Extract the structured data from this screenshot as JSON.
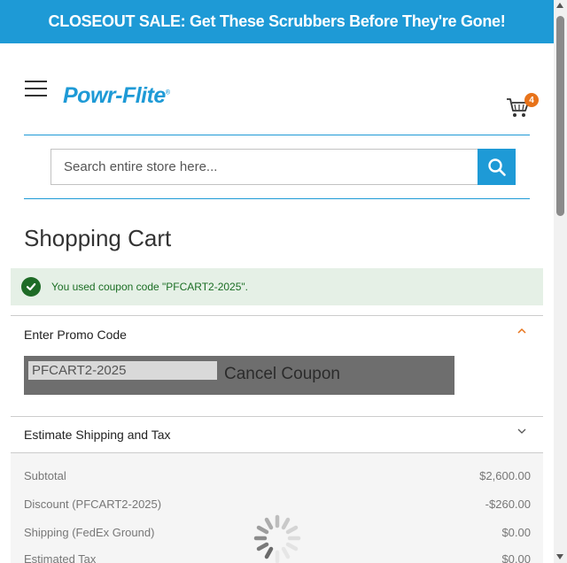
{
  "banner": {
    "text": "CLOSEOUT SALE: Get These Scrubbers Before They're Gone!"
  },
  "header": {
    "logo_text": "Powr-Flite",
    "logo_mark": "®",
    "cart_count": "4"
  },
  "search": {
    "placeholder": "Search entire store here..."
  },
  "page": {
    "title": "Shopping Cart"
  },
  "message": {
    "text": "You used coupon code \"PFCART2-2025\"."
  },
  "promo": {
    "title": "Enter Promo Code",
    "code_value": "PFCART2-2025",
    "cancel_label": "Cancel Coupon"
  },
  "shipping": {
    "title": "Estimate Shipping and Tax"
  },
  "totals": [
    {
      "label": "Subtotal",
      "value": "$2,600.00"
    },
    {
      "label": "Discount (PFCART2-2025)",
      "value": "-$260.00"
    },
    {
      "label": "Shipping (FedEx Ground)",
      "value": "$0.00"
    },
    {
      "label": "Estimated Tax",
      "value": "$0.00"
    }
  ],
  "colors": {
    "brand": "#1e9ad6",
    "accent": "#e8731a",
    "success": "#1e6b26"
  },
  "icons": [
    "menu-icon",
    "cart-icon",
    "search-icon",
    "check-circle-icon",
    "chevron-up-icon",
    "chevron-down-icon",
    "loading-spinner-icon"
  ]
}
